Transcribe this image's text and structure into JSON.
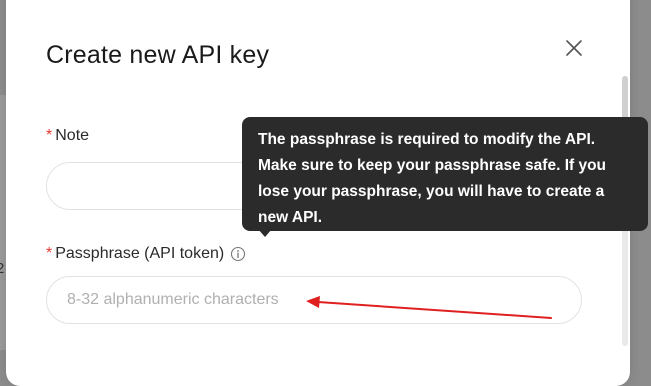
{
  "backdrop": {
    "partial_glyph": "2"
  },
  "modal": {
    "title": "Create new API key",
    "close_icon": "close-icon"
  },
  "fields": {
    "note": {
      "required_mark": "*",
      "label": "Note",
      "value": ""
    },
    "passphrase": {
      "required_mark": "*",
      "label": "Passphrase (API token)",
      "info_icon": "info-icon",
      "placeholder": "8-32 alphanumeric characters",
      "value": ""
    }
  },
  "tooltip": {
    "lines": [
      "The passphrase is required to modify the API.",
      "Make sure to keep your passphrase safe. If you",
      "lose your passphrase, you will have to create a",
      "new API."
    ]
  },
  "colors": {
    "required": "#e53935",
    "tooltip_bg": "#2b2b2b",
    "annotation_arrow": "#e02020"
  }
}
